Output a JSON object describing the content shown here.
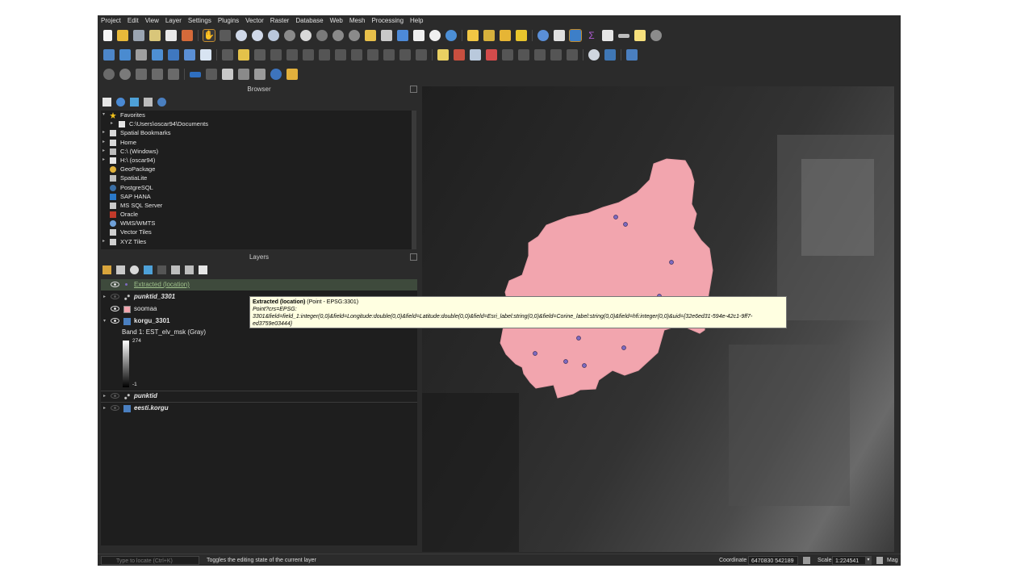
{
  "menubar": [
    "Project",
    "Edit",
    "View",
    "Layer",
    "Settings",
    "Plugins",
    "Vector",
    "Raster",
    "Database",
    "Web",
    "Mesh",
    "Processing",
    "Help"
  ],
  "browser": {
    "title": "Browser",
    "items": [
      {
        "label": "Favorites",
        "icon": "star-icon",
        "arrow": "▾",
        "indent": 0
      },
      {
        "label": "C:\\Users\\oscar94\\Documents",
        "icon": "folder-icon",
        "arrow": "▸",
        "indent": 1
      },
      {
        "label": "Spatial Bookmarks",
        "icon": "bookmark-icon",
        "arrow": "▸",
        "indent": 0
      },
      {
        "label": "Home",
        "icon": "home-folder-icon",
        "arrow": "▸",
        "indent": 0
      },
      {
        "label": "C:\\ (Windows)",
        "icon": "drive-icon",
        "arrow": "▸",
        "indent": 0
      },
      {
        "label": "H:\\ (oscar94)",
        "icon": "drive-icon",
        "arrow": "▸",
        "indent": 0
      },
      {
        "label": "GeoPackage",
        "icon": "geopackage-icon",
        "arrow": "",
        "indent": 0
      },
      {
        "label": "SpatiaLite",
        "icon": "spatialite-icon",
        "arrow": "",
        "indent": 0
      },
      {
        "label": "PostgreSQL",
        "icon": "postgresql-icon",
        "arrow": "",
        "indent": 0
      },
      {
        "label": "SAP HANA",
        "icon": "sap-hana-icon",
        "arrow": "",
        "indent": 0
      },
      {
        "label": "MS SQL Server",
        "icon": "mssql-icon",
        "arrow": "",
        "indent": 0
      },
      {
        "label": "Oracle",
        "icon": "oracle-icon",
        "arrow": "",
        "indent": 0
      },
      {
        "label": "WMS/WMTS",
        "icon": "wms-icon",
        "arrow": "",
        "indent": 0
      },
      {
        "label": "Vector Tiles",
        "icon": "vector-tiles-icon",
        "arrow": "",
        "indent": 0
      },
      {
        "label": "XYZ Tiles",
        "icon": "xyz-tiles-icon",
        "arrow": "▸",
        "indent": 0
      }
    ]
  },
  "layers": {
    "title": "Layers",
    "items": [
      {
        "label": "Extracted (location)",
        "style": "selected"
      },
      {
        "label": "punktid_3301",
        "style": "bold-italic"
      },
      {
        "label": "soomaa",
        "style": "normal"
      },
      {
        "label": "korgu_3301",
        "style": "bold"
      },
      {
        "label": "Band 1: EST_elv_msk (Gray)",
        "style": "sub"
      },
      {
        "label": "punktid",
        "style": "bold-italic"
      },
      {
        "label": "eesti.korgu",
        "style": "bold-italic"
      }
    ],
    "legend_max": "274",
    "legend_min": "-1"
  },
  "tooltip": {
    "title_bold": "Extracted (location)",
    "title_rest": " (Point - EPSG:3301)",
    "line1": "Point?crs=EPSG:",
    "line2": "3301&field=field_1:integer(0,0)&field=Longitude:double(0,0)&field=Latitude:double(0,0)&field=Esri_label:string(0,0)&field=Corine_label:string(0,0)&field=hfi:integer(0,0)&uid={32e6ed31-594e-42c1-9ff7-",
    "line3": "ed3759e03444}"
  },
  "statusbar": {
    "locate_placeholder": "Type to locate (Ctrl+K)",
    "message": "Toggles the editing state of the current layer",
    "coordinate_label": "Coordinate",
    "coordinate_value": "6470830 542189",
    "scale_label": "Scale",
    "scale_value": "1:224541",
    "magnifier_label": "Mag"
  },
  "colors": {
    "polygon_fill": "#f2a5ae",
    "point_fill": "#7d6ac0",
    "tooltip_bg": "#ffffe1",
    "selected_layer": "#3e4a3c"
  }
}
